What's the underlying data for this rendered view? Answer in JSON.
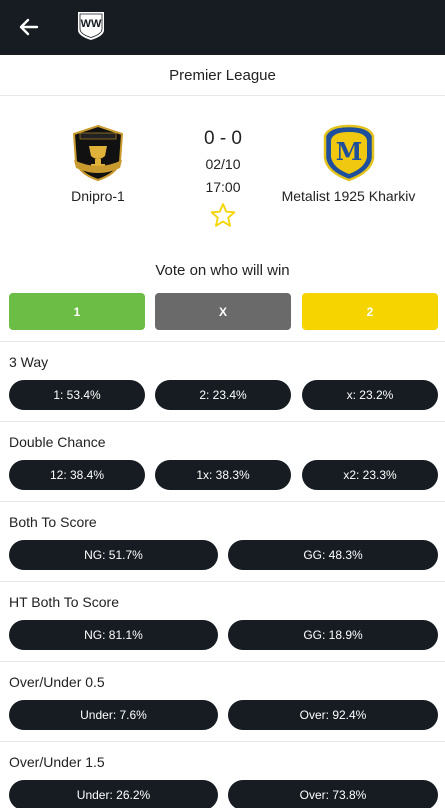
{
  "header": {
    "back_icon": "arrow-left-icon",
    "logo_icon": "ww-shield-logo-icon",
    "logo_text": "WW"
  },
  "match": {
    "league": "Premier League",
    "home_team": "Dnipro-1",
    "away_team": "Metalist 1925 Kharkiv",
    "score": "0 - 0",
    "date": "02/10",
    "time": "17:00",
    "favorite_icon": "star-outline-icon",
    "home_crest_icon": "dnipro-1-crest-icon",
    "away_crest_icon": "metalist-1925-crest-icon",
    "away_crest_letter": "M"
  },
  "vote": {
    "title": "Vote on who will win",
    "options": [
      "1",
      "X",
      "2"
    ],
    "colors": {
      "home": "#6cbd45",
      "draw": "#6a6a6a",
      "away": "#f5d400"
    }
  },
  "markets": [
    {
      "title": "3 Way",
      "options": [
        "1: 53.4%",
        "2: 23.4%",
        "x: 23.2%"
      ]
    },
    {
      "title": "Double Chance",
      "options": [
        "12: 38.4%",
        "1x: 38.3%",
        "x2: 23.3%"
      ]
    },
    {
      "title": "Both To Score",
      "options": [
        "NG: 51.7%",
        "GG: 48.3%"
      ]
    },
    {
      "title": "HT Both To Score",
      "options": [
        "NG: 81.1%",
        "GG: 18.9%"
      ]
    },
    {
      "title": "Over/Under 0.5",
      "options": [
        "Under: 7.6%",
        "Over: 92.4%"
      ]
    },
    {
      "title": "Over/Under 1.5",
      "options": [
        "Under: 26.2%",
        "Over: 73.8%"
      ]
    }
  ],
  "colors": {
    "appbar": "#161c22",
    "pill": "#161c22",
    "accent_star": "#f5d400"
  }
}
